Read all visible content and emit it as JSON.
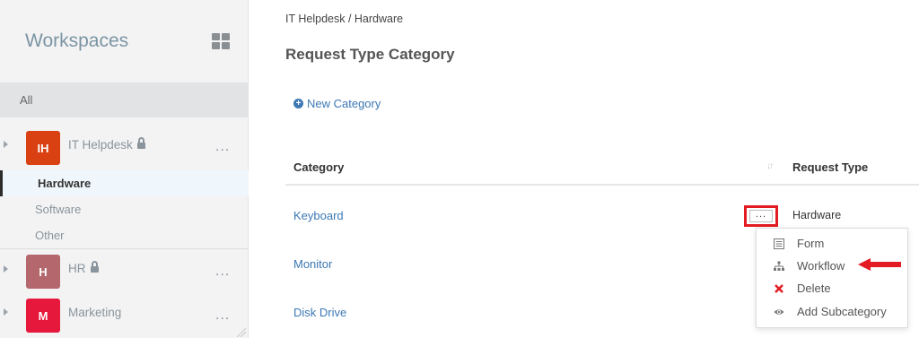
{
  "sidebar": {
    "title": "Workspaces",
    "all_label": "All",
    "workspaces": [
      {
        "initials": "IH",
        "name": "IT Helpdesk",
        "color": "#d94012",
        "more": "...",
        "locked": true,
        "subitems": [
          "Hardware",
          "Software",
          "Other"
        ],
        "active_subitem": "Hardware"
      },
      {
        "initials": "H",
        "name": "HR",
        "color": "#b4686e",
        "more": "...",
        "locked": true
      },
      {
        "initials": "M",
        "name": "Marketing",
        "color": "#e6193c",
        "more": "...",
        "locked": false
      }
    ]
  },
  "main": {
    "breadcrumb": "IT Helpdesk / Hardware",
    "title": "Request Type Category",
    "new_category_label": "New Category",
    "columns": {
      "category": "Category",
      "request_type": "Request Type"
    },
    "rows": [
      {
        "category": "Keyboard",
        "request_type": "Hardware"
      },
      {
        "category": "Monitor",
        "request_type": ""
      },
      {
        "category": "Disk Drive",
        "request_type": ""
      }
    ],
    "more_button": "...",
    "menu": [
      {
        "label": "Form",
        "icon": "form-icon"
      },
      {
        "label": "Workflow",
        "icon": "workflow-icon"
      },
      {
        "label": "Delete",
        "icon": "delete-icon"
      },
      {
        "label": "Add Subcategory",
        "icon": "eye-icon"
      }
    ]
  },
  "colors": {
    "link": "#3c78b4",
    "highlight": "#e31b23",
    "delete": "#e31b23"
  }
}
